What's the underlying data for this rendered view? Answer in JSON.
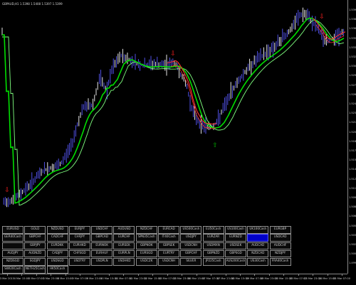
{
  "chart": {
    "header": "GBPAUD,H1 1.5398 1.5408 1.5397 1.5399",
    "price_ticks": [
      "1.5395",
      "1.5380",
      "1.5365",
      "1.5350",
      "1.5335",
      "1.5320",
      "1.5305",
      "1.5290",
      "1.5275",
      "1.5260",
      "1.5245",
      "1.5230",
      "1.5215",
      "1.5200",
      "1.5185",
      "1.5170",
      "1.5155",
      "1.5140",
      "1.5125",
      "1.5110",
      "1.5095",
      "1.5080",
      "1.5065",
      "1.5050",
      "1.5035",
      "1.5020",
      "1.5005",
      "1.4990"
    ],
    "time_ticks": [
      "3 Mar 2015",
      "4 Mar 15:00",
      "5 Mar 07:00",
      "5 Mar 23:00",
      "6 Mar 15:00",
      "9 Mar 07:00",
      "9 Mar 23:00",
      "10 Mar 15:00",
      "11 Mar 07:00",
      "11 Mar 23:00",
      "12 Mar 15:00",
      "13 Mar 07:00",
      "13 Mar 23:00",
      "16 Mar 15:00",
      "17 Mar 07:00",
      "17 Mar 23:00",
      "18 Mar 15:00",
      "19 Mar 07:00",
      "19 Mar 23:00",
      "20 Mar 15:00",
      "23 Mar 07:00",
      "23 Mar 23:00",
      "24 Mar 15:00",
      "25 Mar 07:00"
    ],
    "colors": {
      "background": "#000000",
      "candles": "#5a5aff",
      "ma_fast": "#00e000",
      "ma_slow": "#7fff7f",
      "ma_red": "#ff3030",
      "signal_down": "#ff2020",
      "signal_up": "#00b000"
    },
    "signals": [
      {
        "type": "down",
        "icon": "down-arrow-signal-icon"
      },
      {
        "type": "down",
        "icon": "down-arrow-signal-icon"
      },
      {
        "type": "up",
        "icon": "up-arrow-signal-icon"
      },
      {
        "type": "down",
        "icon": "down-arrow-signal-icon"
      }
    ]
  },
  "symbols": [
    "EURUSD",
    "GOLD",
    "NZDUSD",
    "EURJPY",
    "USDCHF",
    "AUDUSD",
    "NZDCHF",
    "EURCAD",
    "US500Cash",
    "EU50Cash",
    "US100Cash",
    "UK100Cash",
    "EURGBP",
    "GER40Cash",
    "GBPCHF",
    "CADCHF",
    "CHFJPY",
    "GBPCAD",
    "EURCHF",
    "SPN35Cash",
    "IT40Cash",
    "USDJPY",
    "EURZAR",
    "EURNZD",
    "GBPAUD",
    "USDCAD",
    "",
    "GBPJPY",
    "EURDKK",
    "EURHKD",
    "EURNOK",
    "EURSEK",
    "GBPNOK",
    "GBPSEK",
    "USDCNH",
    "USDMXN",
    "USDSEK",
    "AUDCAD",
    "AUDCHF",
    "AUDJPY",
    "AUDNZD",
    "CADJPY",
    "CHFSGD",
    "EURHUF",
    "EURPLN",
    "EURSGD",
    "EURTRY",
    "GBPCHF",
    "GBPNZD",
    "GBPSGD",
    "NZDCAD",
    "NZDJPY",
    "NZDSGD",
    "SGDJPY",
    "USDSGD",
    "USDTRY",
    "USDPLN",
    "USDHKD",
    "USDCZK",
    "USDCNH",
    "SILVER",
    "JP225Cash",
    "AUS200Cash",
    "US30Cash",
    "FRA40Cash",
    "SWI20Cash",
    "NETH25Cash",
    "HK50Cash"
  ],
  "selected_symbol": "GBPAUD"
}
